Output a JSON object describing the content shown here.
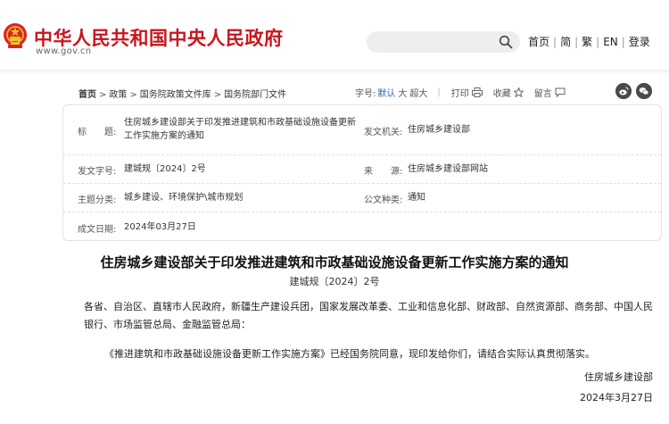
{
  "header": {
    "site_title": "中华人民共和国中央人民政府",
    "site_url": "www.gov.cn",
    "search_placeholder": "",
    "nav": [
      "首页",
      "简",
      "繁",
      "EN",
      "登录"
    ]
  },
  "breadcrumb": [
    "首页",
    "政策",
    "国务院政策文件库",
    "国务院部门文件"
  ],
  "tools": {
    "font_size_label": "字号:",
    "font_default": "默认",
    "font_large": "大",
    "font_xlarge": "超大",
    "print": "打印",
    "favorite": "收藏",
    "message": "留言"
  },
  "meta": {
    "title_label": "标　　题:",
    "title_value": "住房城乡建设部关于印发推进建筑和市政基础设施设备更新工作实施方案的通知",
    "issuer_label": "发文机关:",
    "issuer_value": "住房城乡建设部",
    "doc_no_label": "发文字号:",
    "doc_no_value": "建城规〔2024〕2号",
    "source_label": "来　　源:",
    "source_value": "住房城乡建设部网站",
    "topic_label": "主题分类:",
    "topic_value": "城乡建设、环境保护\\城市规划",
    "doc_type_label": "公文种类:",
    "doc_type_value": "通知",
    "date_label": "成文日期:",
    "date_value": "2024年03月27日"
  },
  "document": {
    "title": "住房城乡建设部关于印发推进建筑和市政基础设施设备更新工作实施方案的通知",
    "number": "建城规〔2024〕2号",
    "addressees": "各省、自治区、直辖市人民政府，新疆生产建设兵团，国家发展改革委、工业和信息化部、财政部、自然资源部、商务部、中国人民银行、市场监管总局、金融监管总局：",
    "body": "《推进建筑和市政基础设施设备更新工作实施方案》已经国务院同意，现印发给你们，请结合实际认真贯彻落实。",
    "signer": "住房城乡建设部",
    "sign_date": "2024年3月27日"
  },
  "colors": {
    "brand_red": "#c8161d",
    "link_blue": "#2a64b4"
  }
}
